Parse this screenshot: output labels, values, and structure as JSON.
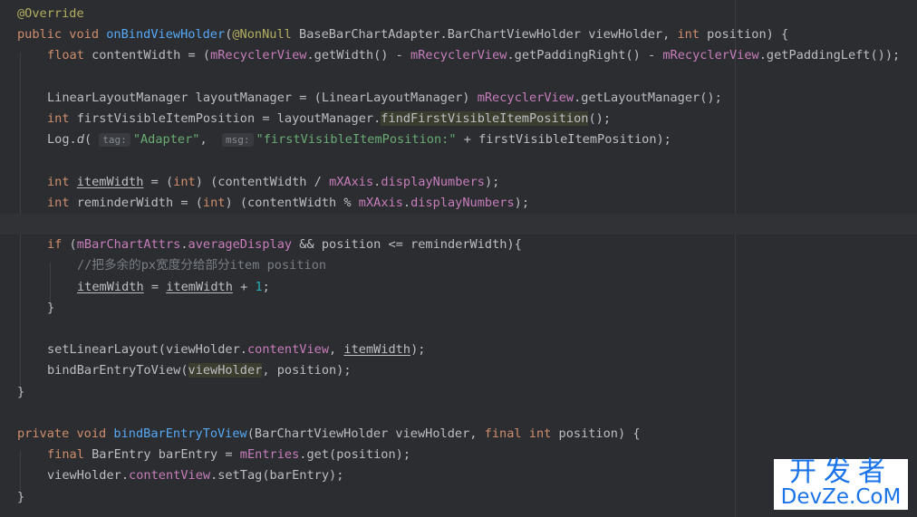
{
  "code": {
    "l1": {
      "annotation": "@Override"
    },
    "l2": {
      "kw1": "public",
      "kw2": "void",
      "method": "onBindViewHolder",
      "p1": "(",
      "ann": "@NonNull",
      "p2": " BaseBarChartAdapter.BarChartViewHolder viewHolder, ",
      "kw3": "int",
      "p3": " position) {"
    },
    "l3": {
      "kw1": "float",
      "p1": " contentWidth = (",
      "f1": "mRecyclerView",
      "p2": ".getWidth() - ",
      "f2": "mRecyclerView",
      "p3": ".getPaddingRight() - ",
      "f3": "mRecyclerView",
      "p4": ".getPaddingLeft());"
    },
    "l5": {
      "p1": "LinearLayoutManager layoutManager = (LinearLayoutManager) ",
      "f1": "mRecyclerView",
      "p2": ".getLayoutManager();"
    },
    "l6": {
      "kw1": "int",
      "p1": " firstVisibleItemPosition = layoutManager.",
      "hl": "findFirstVisibleItemPosition",
      "p2": "();"
    },
    "l7": {
      "p1": "Log.",
      "m": "d",
      "p2": "( ",
      "h1": "tag:",
      "s1": "\"Adapter\"",
      "p3": ",  ",
      "h2": "msg:",
      "s2": "\"firstVisibleItemPosition:\"",
      "p4": " + firstVisibleItemPosition);"
    },
    "l9": {
      "kw1": "int",
      "p0": " ",
      "v": "itemWidth",
      "p1": " = (",
      "kw2": "int",
      "p2": ") (contentWidth / ",
      "f1": "mXAxis",
      "p3": ".",
      "f2": "displayNumbers",
      "p4": ");"
    },
    "l10": {
      "kw1": "int",
      "p1": " reminderWidth = (",
      "kw2": "int",
      "p2": ") (contentWidth % ",
      "f1": "mXAxis",
      "p3": ".",
      "f2": "displayNumbers",
      "p4": ");"
    },
    "l12": {
      "kw1": "if",
      "p1": " (",
      "f1": "mBarChartAttrs",
      "p2": ".",
      "f2": "averageDisplay",
      "p3": " && position <= reminderWidth){"
    },
    "l13": {
      "comment": "//把多余的px宽度分给部分item position"
    },
    "l14": {
      "v1": "itemWidth",
      "p1": " = ",
      "v2": "itemWidth",
      "p2": " + ",
      "n": "1",
      "p3": ";"
    },
    "l15": {
      "p1": "}"
    },
    "l17": {
      "p1": "setLinearLayout(viewHolder.",
      "f1": "contentView",
      "p2": ", ",
      "v": "itemWidth",
      "p3": ");"
    },
    "l18": {
      "p1": "bindBarEntryToView(",
      "hl": "viewHolder",
      "p2": ", position);"
    },
    "l19": {
      "p1": "}"
    },
    "l21": {
      "kw1": "private",
      "kw2": "void",
      "method": "bindBarEntryToView",
      "p1": "(BarChartViewHolder viewHolder, ",
      "kw3": "final",
      "kw4": "int",
      "p2": " position) {"
    },
    "l22": {
      "kw1": "final",
      "p1": " BarEntry barEntry = ",
      "f1": "mEntries",
      "p2": ".get(position);"
    },
    "l23": {
      "p1": "viewHolder.",
      "f1": "contentView",
      "p2": ".setTag(barEntry);"
    },
    "l24": {
      "p1": "}"
    }
  },
  "watermark": {
    "cn": "开发者",
    "en": "DevZe.CoM"
  }
}
